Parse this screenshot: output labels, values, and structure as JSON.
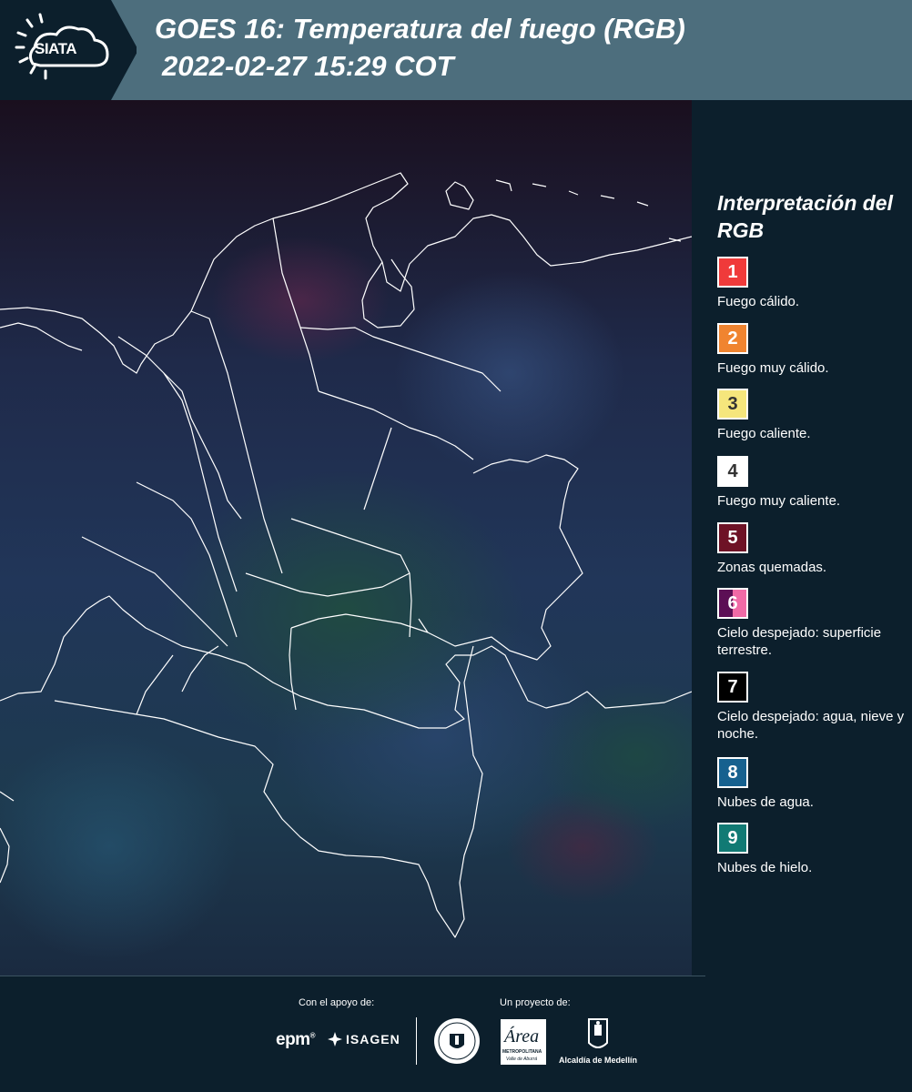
{
  "header": {
    "logo_text": "SIATA",
    "title_line1": "GOES 16: Temperatura del fuego (RGB)",
    "title_line2": "2022-02-27 15:29 COT",
    "background_color": "#4d6e7d"
  },
  "map": {
    "description_icon": "satellite-image-colombia",
    "border_color": "#ffffff"
  },
  "legend": {
    "title": "Interpretación del RGB",
    "items": [
      {
        "number": "1",
        "label": "Fuego cálido.",
        "color": "#f03a3a"
      },
      {
        "number": "2",
        "label": "Fuego muy cálido.",
        "color": "#f08430"
      },
      {
        "number": "3",
        "label": "Fuego caliente.",
        "color": "#f5e67c"
      },
      {
        "number": "4",
        "label": "Fuego muy caliente.",
        "color": "#ffffff"
      },
      {
        "number": "5",
        "label": "Zonas quemadas.",
        "color": "#6e1226"
      },
      {
        "number": "6",
        "label": "Cielo despejado: superficie terrestre.",
        "color": "#5c0f55",
        "color2": "#f06aa6"
      },
      {
        "number": "7",
        "label": "Cielo despejado: agua, nieve y noche.",
        "color": "#000000"
      },
      {
        "number": "8",
        "label": "Nubes de agua.",
        "color": "#16618f"
      },
      {
        "number": "9",
        "label": "Nubes de hielo.",
        "color": "#117a74"
      }
    ]
  },
  "footer": {
    "support_label": "Con el apoyo de:",
    "project_label": "Un proyecto de:",
    "epm_logo": "epm",
    "isagen_logo": "ISAGEN",
    "area_logo": "Área",
    "area_sub": "METROPOLITANA",
    "area_sub2": "Valle de Aburrá",
    "medellin_logo": "Alcaldía de Medellín"
  }
}
